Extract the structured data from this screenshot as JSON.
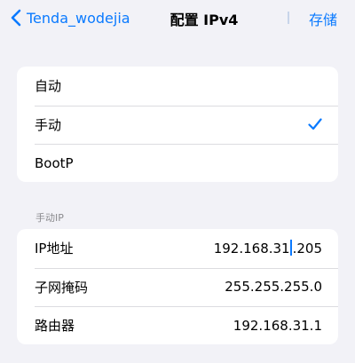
{
  "nav": {
    "back_label": "Tenda_wodejia",
    "title": "配置 IPv4",
    "save_label": "存储"
  },
  "config_options": [
    {
      "label": "自动",
      "selected": false
    },
    {
      "label": "手动",
      "selected": true
    },
    {
      "label": "BootP",
      "selected": false
    }
  ],
  "manual_section": {
    "header": "手动IP",
    "fields": [
      {
        "label": "IP地址",
        "value_before_cursor": "192.168.31",
        "value_after_cursor": ".205"
      },
      {
        "label": "子网掩码",
        "value": "255.255.255.0"
      },
      {
        "label": "路由器",
        "value": "192.168.31.1"
      }
    ]
  },
  "colors": {
    "accent": "#0a7aff",
    "background": "#f2f2f7",
    "section_header": "#8a8a8e"
  }
}
